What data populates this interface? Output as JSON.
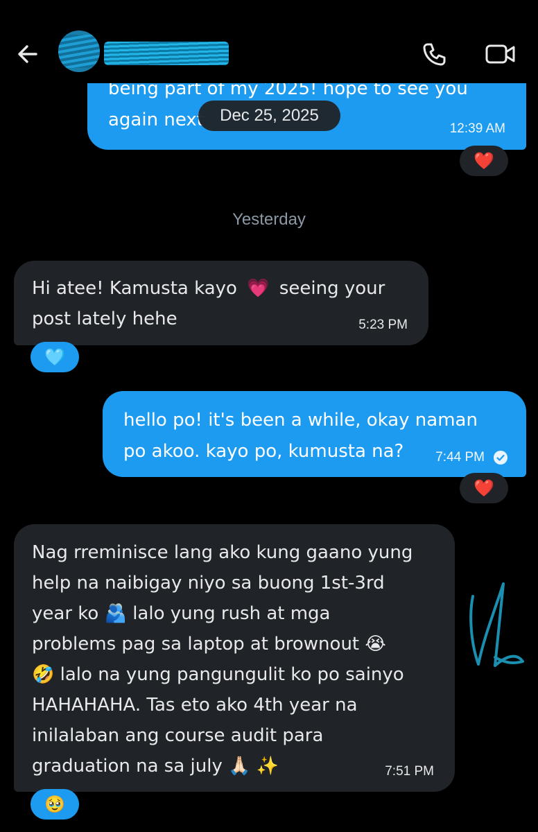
{
  "header": {
    "back_icon": "arrow-left-icon",
    "call_icon": "phone-icon",
    "video_icon": "video-camera-icon"
  },
  "colors": {
    "outgoing_bubble": "#1d9bf0",
    "incoming_bubble": "#202327",
    "background": "#000000"
  },
  "date_chip": "Dec 25, 2025",
  "day_separator": "Yesterday",
  "messages": [
    {
      "direction": "outgoing",
      "lines": [
        "being part of my 2025! hope to see you",
        "again next"
      ],
      "time": "12:39 AM",
      "reaction": "❤️"
    },
    {
      "direction": "incoming",
      "lines": [
        "Hi atee! Kamusta kayo",
        "seeing your",
        "post lately hehe"
      ],
      "emoji": "💗",
      "time": "5:23 PM",
      "reaction": "🩵"
    },
    {
      "direction": "outgoing",
      "lines": [
        "hello po! it's been a while, okay naman",
        "po akoo. kayo po, kumusta na?"
      ],
      "time": "7:44 PM",
      "status_icon": "check-circle-icon",
      "reaction": "❤️"
    },
    {
      "direction": "incoming",
      "lines": [
        "Nag rreminisce lang ako kung gaano yung",
        "help na naibigay niyo sa buong 1st-3rd",
        "year ko 🫂 lalo yung rush at mga",
        "problems pag sa laptop at brownout 😭",
        "🤣 lalo na yung pangungulit ko po sainyo",
        "HAHAHAHA. Tas eto ako 4th year na",
        "inilalaban ang course audit para",
        "graduation na sa july 🙏🏻 ✨"
      ],
      "time": "7:51 PM",
      "reaction": "🥹"
    }
  ]
}
